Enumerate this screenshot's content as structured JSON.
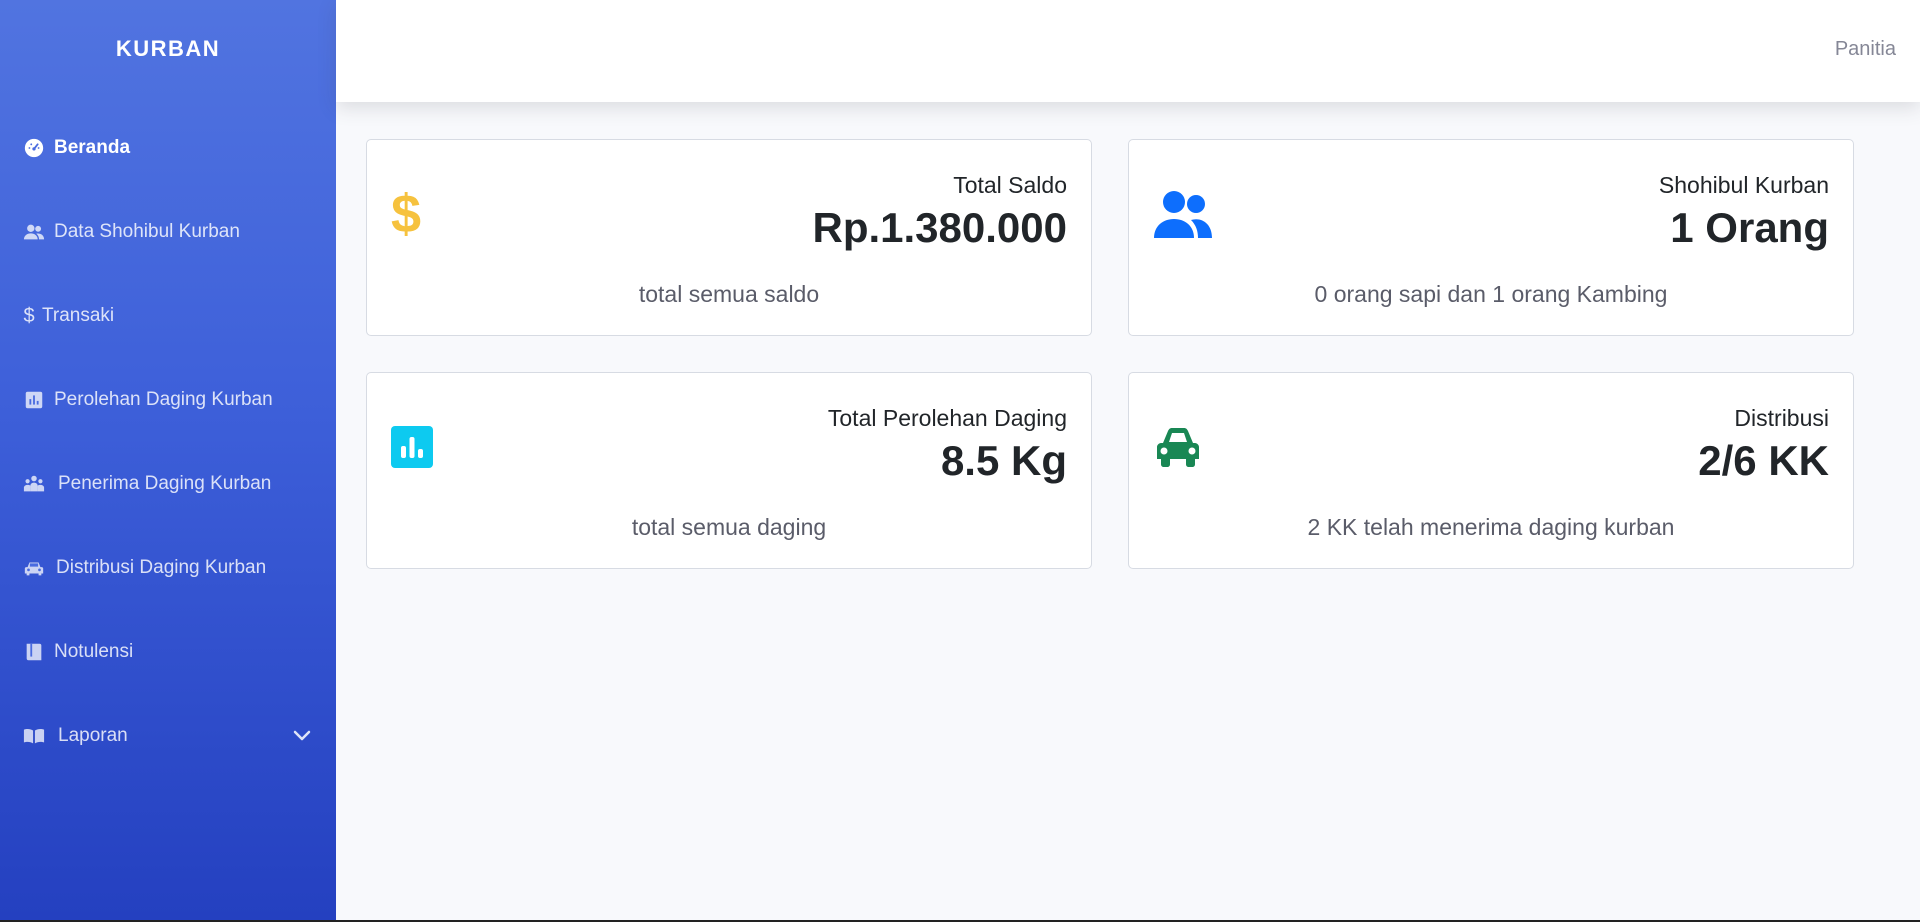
{
  "brand": "KURBAN",
  "sidebar": {
    "items": [
      {
        "label": "Beranda",
        "icon": "dashboard-icon"
      },
      {
        "label": "Data Shohibul Kurban",
        "icon": "users-icon"
      },
      {
        "label": "Transaki",
        "icon": "dollar-icon"
      },
      {
        "label": "Perolehan Daging Kurban",
        "icon": "chart-icon"
      },
      {
        "label": "Penerima Daging Kurban",
        "icon": "people-icon"
      },
      {
        "label": "Distribusi Daging Kurban",
        "icon": "car-icon"
      },
      {
        "label": "Notulensi",
        "icon": "book-icon"
      },
      {
        "label": "Laporan",
        "icon": "open-book-icon"
      }
    ]
  },
  "topbar": {
    "user": "Panitia"
  },
  "cards": [
    {
      "label": "Total Saldo",
      "value": "Rp.1.380.000",
      "sub": "total semua saldo",
      "icon": "dollar-icon",
      "color": "#f6c23e"
    },
    {
      "label": "Shohibul Kurban",
      "value": "1 Orang",
      "sub": "0 orang sapi dan 1 orang Kambing",
      "icon": "users-icon",
      "color": "#0d6efd"
    },
    {
      "label": "Total Perolehan Daging",
      "value": "8.5 Kg",
      "sub": "total semua daging",
      "icon": "chart-icon",
      "color": "#0dcaf0"
    },
    {
      "label": "Distribusi",
      "value": "2/6 KK",
      "sub": "2 KK telah menerima daging kurban",
      "icon": "car-icon",
      "color": "#198754"
    }
  ]
}
